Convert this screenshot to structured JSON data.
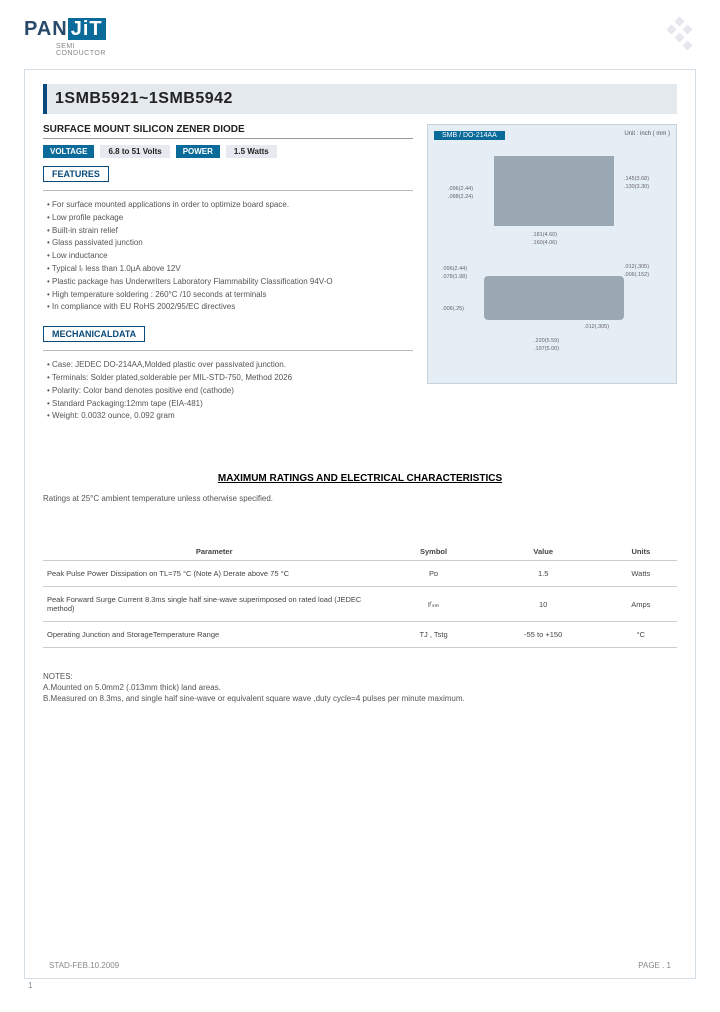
{
  "logo": {
    "brand_p": "PAN",
    "brand_j": "JiT",
    "sub1": "SEMI",
    "sub2": "CONDUCTOR"
  },
  "title": "1SMB5921~1SMB5942",
  "subtitle": "SURFACE MOUNT SILICON ZENER DIODE",
  "specs": {
    "voltage_label": "VOLTAGE",
    "voltage_value": "6.8 to 51 Volts",
    "power_label": "POWER",
    "power_value": "1.5 Watts"
  },
  "features_label": "FEATURES",
  "features": [
    "For surface mounted applications in order to optimize board space.",
    "Low profile package",
    "Built-in strain relief",
    "Glass passivated junction",
    "Low inductance",
    "Typical Iᵣ less than 1.0µA above 12V",
    "Plastic package has Underwriters Laboratory Flammability Classification 94V-O",
    "High temperature soldering : 260°C /10 seconds at terminals",
    "In compliance with EU RoHS 2002/95/EC directives"
  ],
  "mechdata_label": "MECHANICALDATA",
  "mechdata": [
    "Case: JEDEC DO-214AA,Molded plastic over passivated junction.",
    "Terminals: Solder plated,solderable per MIL-STD-750, Method 2026",
    "Polarity: Color band denotes positive end (cathode)",
    "Standard Packaging:12mm tape (EIA-481)",
    "Weight: 0.0032 ounce, 0.092 gram"
  ],
  "package": {
    "label": "SMB / DO-214AA",
    "unit": "Unit : inch ( mm )",
    "dims": {
      "d1": ".096(2.44)",
      "d2": ".088(2.24)",
      "d3": ".181(4.60)",
      "d4": ".160(4.06)",
      "d5": ".145(3.68)",
      "d6": ".130(3.30)",
      "d7": ".012(.305)",
      "d8": ".006(.152)",
      "d9": ".096(2.44)",
      "d10": ".078(1.98)",
      "d11": ".220(5.59)",
      "d12": ".197(5.00)",
      "d13": ".006(.25)",
      "d14": ".012(.305)"
    }
  },
  "ratings_title": "MAXIMUM RATINGS AND ELECTRICAL CHARACTERISTICS",
  "ratings_note": "Ratings at 25°C ambient temperature unless otherwise specified.",
  "table": {
    "headers": {
      "param": "Parameter",
      "symbol": "Symbol",
      "value": "Value",
      "units": "Units"
    },
    "rows": [
      {
        "param": "Peak Pulse Power Dissipation on TL=75 °C (Note A) Derate above 75 °C",
        "symbol": "Pᴅ",
        "value": "1.5",
        "units": "Watts"
      },
      {
        "param": "Peak Forward Surge Current 8.3ms single half sine-wave superimposed on rated load (JEDEC method)",
        "symbol": "Iᶠₛₘ",
        "value": "10",
        "units": "Amps"
      },
      {
        "param": "Operating Junction and StorageTemperature Range",
        "symbol": "TJ , Tstg",
        "value": "-55 to +150",
        "units": "°C"
      }
    ]
  },
  "notes": {
    "title": "NOTES:",
    "a": "A.Mounted on 5.0mm2 (.013mm thick) land areas.",
    "b": "B.Measured on 8.3ms, and single half sine-wave or equivalent square wave ,duty cycle=4 pulses per minute maximum."
  },
  "footer": {
    "left": "STAD-FEB.10.2009",
    "right": "PAGE .  1",
    "below": "1"
  }
}
